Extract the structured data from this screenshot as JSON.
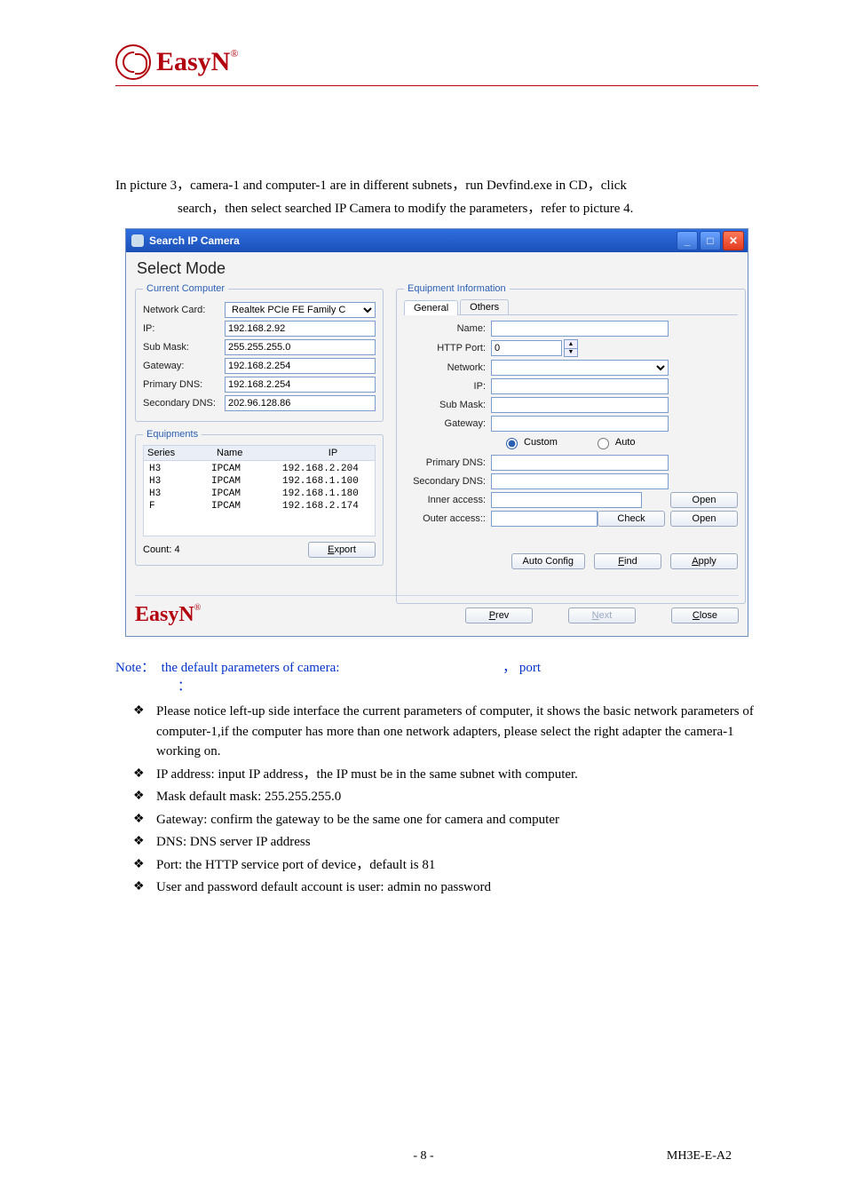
{
  "logo": {
    "text": "EasyN"
  },
  "caption": {
    "line1": "In picture 3，camera-1 and computer-1 are in different subnets，run Devfind.exe   in CD，click",
    "line2": "search，then select searched IP Camera to modify the parameters，refer to picture 4."
  },
  "window": {
    "title": "Search IP Camera",
    "mode_title": "Select Mode",
    "current_computer": {
      "legend": "Current Computer",
      "labels": {
        "network_card": "Network Card:",
        "ip": "IP:",
        "sub_mask": "Sub Mask:",
        "gateway": "Gateway:",
        "primary_dns": "Primary DNS:",
        "secondary_dns": "Secondary DNS:"
      },
      "values": {
        "network_card": "Realtek PCIe FE Family C",
        "ip": "192.168.2.92",
        "sub_mask": "255.255.255.0",
        "gateway": "192.168.2.254",
        "primary_dns": "192.168.2.254",
        "secondary_dns": "202.96.128.86"
      }
    },
    "equipments": {
      "legend": "Equipments",
      "headers": {
        "series": "Series",
        "name": "Name",
        "ip": "IP"
      },
      "rows": [
        {
          "series": "H3",
          "name": "IPCAM",
          "ip": "192.168.2.204"
        },
        {
          "series": "H3",
          "name": "IPCAM",
          "ip": "192.168.1.100"
        },
        {
          "series": "H3",
          "name": "IPCAM",
          "ip": "192.168.1.180"
        },
        {
          "series": "F",
          "name": "IPCAM",
          "ip": "192.168.2.174"
        }
      ],
      "count_label": "Count: 4",
      "export": "Export"
    },
    "equip_info": {
      "legend": "Equipment Information",
      "tabs": {
        "general": "General",
        "others": "Others"
      },
      "labels": {
        "name": "Name:",
        "http_port": "HTTP Port:",
        "network": "Network:",
        "ip": "IP:",
        "sub_mask": "Sub Mask:",
        "gateway": "Gateway:",
        "custom": "Custom",
        "auto": "Auto",
        "primary_dns": "Primary DNS:",
        "secondary_dns": "Secondary DNS:",
        "inner_access": "Inner access:",
        "outer_access": "Outer access::"
      },
      "values": {
        "http_port": "0"
      },
      "buttons": {
        "open": "Open",
        "check": "Check",
        "auto_config": "Auto Config",
        "find": "Find",
        "apply": "Apply",
        "prev": "Prev",
        "next": "Next",
        "close": "Close"
      }
    },
    "bottom_logo": "EasyN"
  },
  "note": {
    "prefix": "Note：",
    "line": "the default parameters of camera:",
    "sep": "，",
    "port": "port",
    "colon": "："
  },
  "bullets": [
    "Please notice left-up side interface the current parameters of computer, it shows the basic network parameters of computer-1,if the computer has more than one network adapters, please select the right adapter the camera-1 working on.",
    "IP address: input IP address，the IP must be in the same subnet with computer.",
    "Mask  default mask: 255.255.255.0",
    "Gateway: confirm the gateway to be the same one for camera and computer",
    "DNS: DNS server IP address",
    "Port: the HTTP service port of device，default is 81",
    "User and password  default account is user: admin no password"
  ],
  "footer": {
    "page": "- 8 -",
    "doc": "MH3E-E-A2"
  }
}
